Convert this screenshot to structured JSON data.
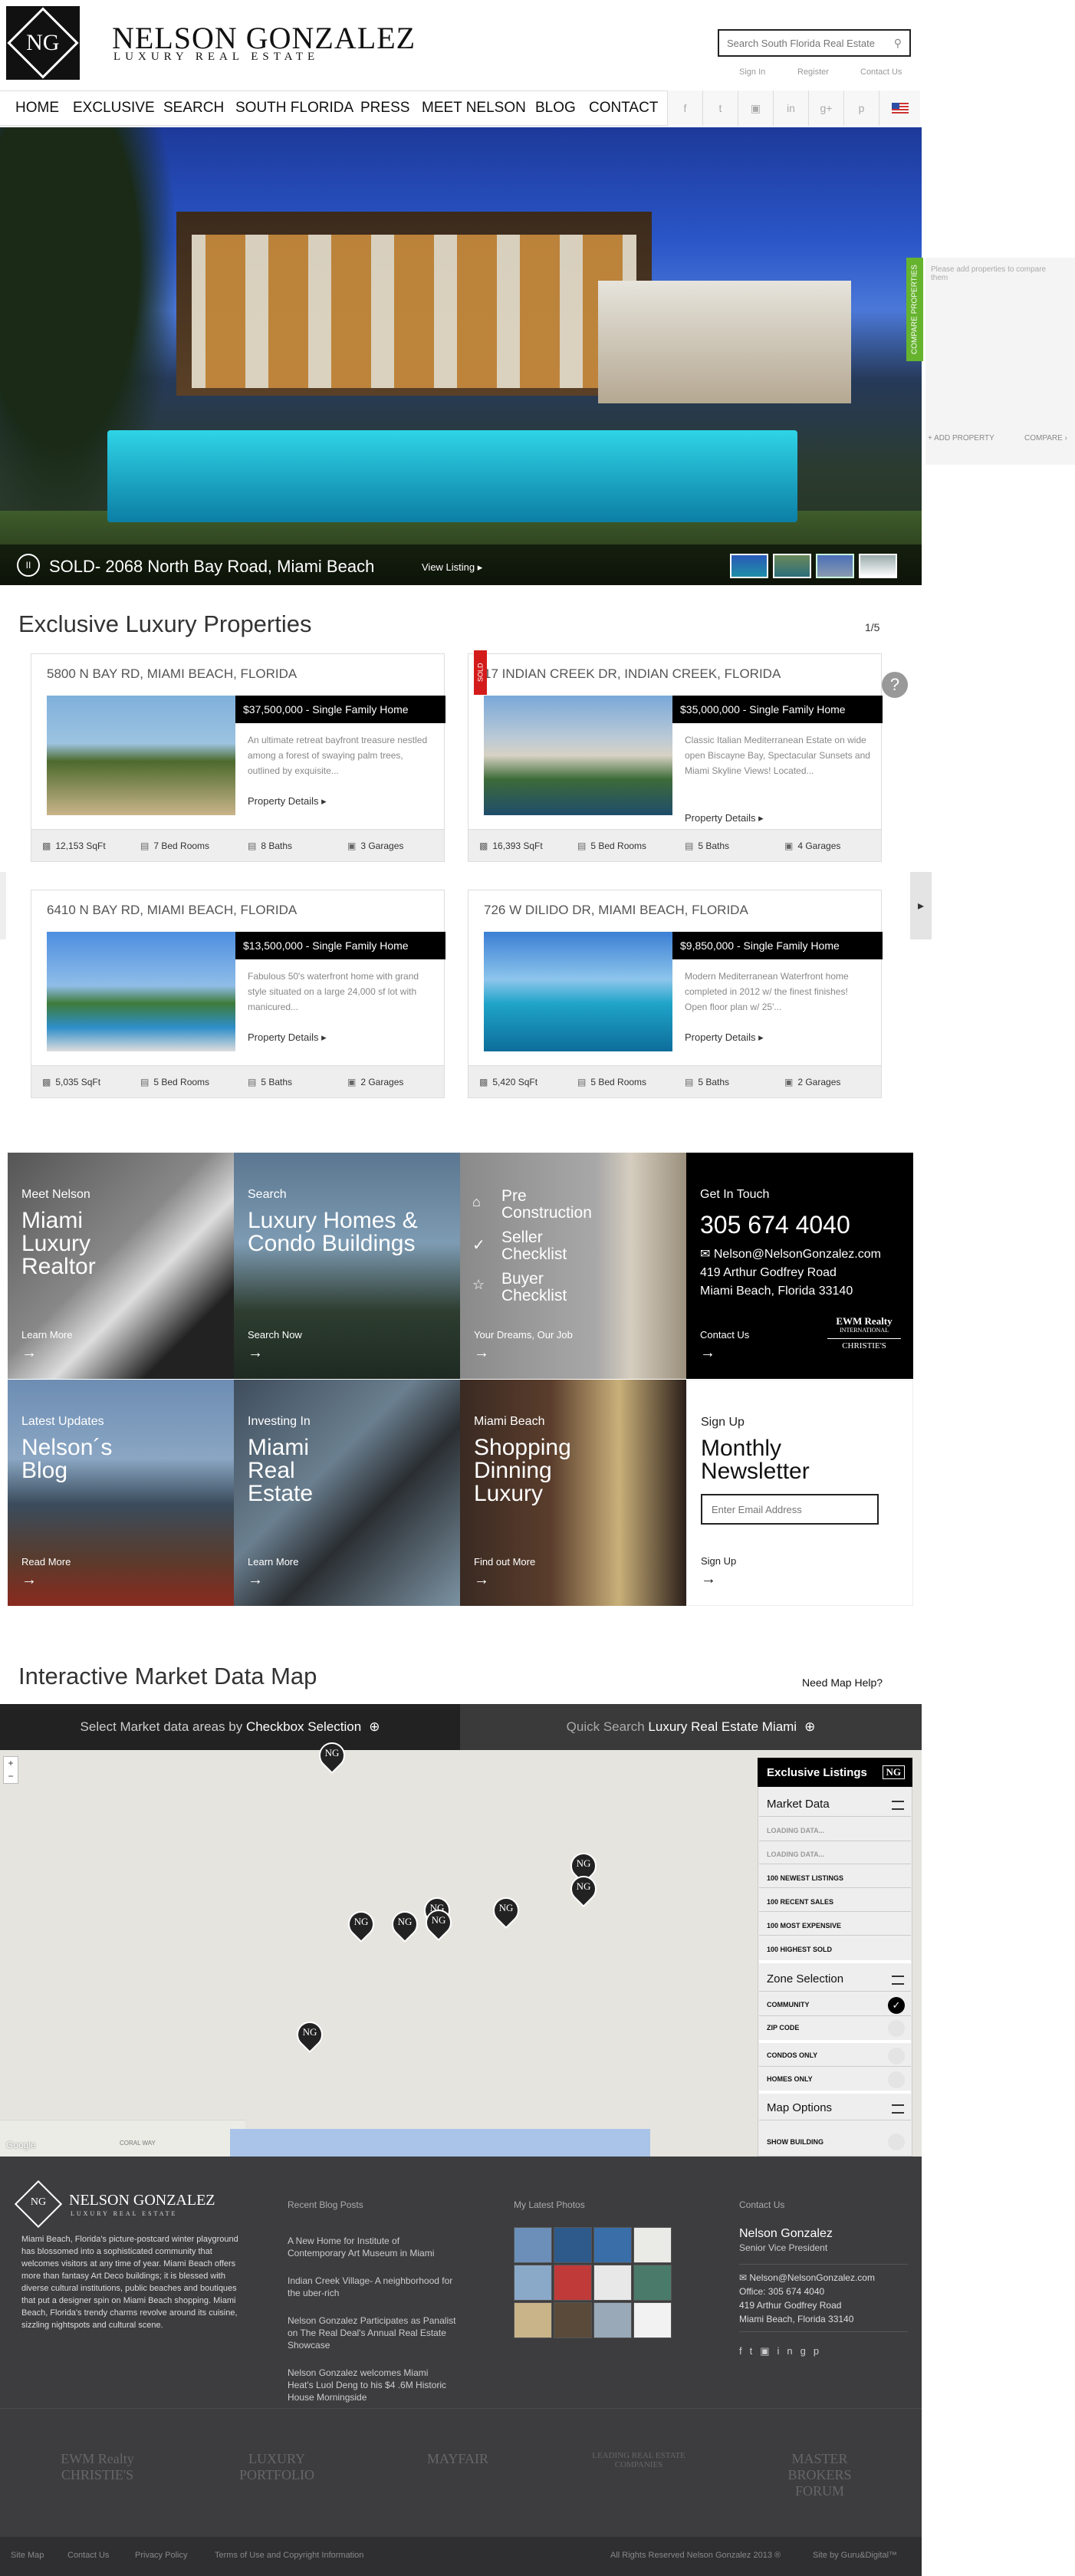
{
  "brand": {
    "mark": "NG",
    "name": "NELSON GONZALEZ",
    "tagline": "LUXURY REAL ESTATE"
  },
  "search": {
    "placeholder": "Search South Florida Real Estate"
  },
  "toplinks": [
    "Sign In",
    "Register",
    "Contact Us"
  ],
  "nav": [
    "HOME",
    "EXCLUSIVE",
    "SEARCH",
    "SOUTH FLORIDA",
    "PRESS",
    "MEET NELSON",
    "BLOG",
    "CONTACT"
  ],
  "social_icons": [
    "facebook-icon",
    "twitter-icon",
    "instagram-icon",
    "linkedin-icon",
    "google-plus-icon",
    "pinterest-icon",
    "us-flag-icon"
  ],
  "hero": {
    "caption": "SOLD- 2068 North Bay Road, Miami Beach",
    "view_listing": "View Listing ▸",
    "pause": "II"
  },
  "compare": {
    "tab": "COMPARE PROPERTIES",
    "note": "Please add properties to compare them",
    "add": "+ ADD PROPERTY",
    "compare": "COMPARE ›"
  },
  "exclusive": {
    "title": "Exclusive Luxury Properties",
    "page": "1/5",
    "sold": "SOLD",
    "details_label": "Property Details ▸",
    "properties": [
      {
        "address": "5800 N BAY RD, MIAMI BEACH, FLORIDA",
        "price": "$37,500,000 - Single Family Home",
        "desc": "An ultimate retreat bayfront treasure nestled among a forest of swaying palm trees, outlined by exquisite...",
        "sqft": "12,153 SqFt",
        "beds": "7 Bed Rooms",
        "baths": "8 Baths",
        "garages": "3 Garages"
      },
      {
        "address": "17 INDIAN CREEK DR, INDIAN CREEK, FLORIDA",
        "price": "$35,000,000 - Single Family Home",
        "desc": "Classic Italian Mediterranean Estate on wide open Biscayne Bay, Spectacular Sunsets and Miami Skyline Views! Located...",
        "sqft": "16,393 SqFt",
        "beds": "5 Bed Rooms",
        "baths": "5 Baths",
        "garages": "4 Garages"
      },
      {
        "address": "6410 N BAY RD, MIAMI BEACH, FLORIDA",
        "price": "$13,500,000 - Single Family Home",
        "desc": "Fabulous 50's waterfront home with grand style situated on a large 24,000 sf lot with manicured...",
        "sqft": "5,035 SqFt",
        "beds": "5 Bed Rooms",
        "baths": "5 Baths",
        "garages": "2 Garages"
      },
      {
        "address": "726 W DILIDO DR, MIAMI BEACH, FLORIDA",
        "price": "$9,850,000 - Single Family Home",
        "desc": "Modern Mediterranean Waterfront home completed in 2012 w/ the finest finishes! Open floor plan w/ 25'...",
        "sqft": "5,420 SqFt",
        "beds": "5 Bed Rooms",
        "baths": "5 Baths",
        "garages": "2 Garages"
      }
    ]
  },
  "tiles": {
    "meet": {
      "label": "Meet Nelson",
      "big": "Miami Luxury Realtor",
      "foot": "Learn More"
    },
    "search": {
      "label": "Search",
      "big": "Luxury Homes & Condo Buildings",
      "foot": "Search Now"
    },
    "checklist": {
      "items": [
        "Pre Construction",
        "Seller Checklist",
        "Buyer Checklist"
      ],
      "foot": "Your Dreams, Our Job"
    },
    "contact": {
      "label": "Get In Touch",
      "phone": "305 674 4040",
      "email": "Nelson@NelsonGonzalez.com",
      "addr1": "419 Arthur Godfrey Road",
      "addr2": "Miami Beach, Florida 33140",
      "foot": "Contact Us",
      "logo1": "EWM Realty",
      "logo2": "INTERNATIONAL",
      "logo3": "CHRISTIE'S"
    },
    "blog": {
      "label": "Latest Updates",
      "big": "Nelson´s Blog",
      "foot": "Read More"
    },
    "invest": {
      "label": "Investing In",
      "big": "Miami Real Estate",
      "foot": "Learn More"
    },
    "shop": {
      "label": "Miami Beach",
      "big": "Shopping Dinning Luxury",
      "foot": "Find out More"
    },
    "newsletter": {
      "label": "Sign Up",
      "big": "Monthly Newsletter",
      "placeholder": "Enter Email Address",
      "foot": "Sign Up"
    }
  },
  "map": {
    "title": "Interactive Market Data Map",
    "help": "Need Map Help?",
    "tab1_pre": "Select Market data areas by ",
    "tab1_bold": "Checkbox Selection",
    "tab2_pre": "Quick Search ",
    "tab2_bold": "Luxury Real Estate Miami",
    "google": "Google",
    "pin_label": "NG",
    "place_label": "CORAL WAY",
    "panel": {
      "title": "Exclusive Listings",
      "market": "Market Data",
      "loading": [
        "LOADING DATA...",
        "LOADING DATA..."
      ],
      "items": [
        "100 NEWEST LISTINGS",
        "100 RECENT SALES",
        "100 MOST EXPENSIVE",
        "100 HIGHEST SOLD"
      ],
      "zone": "Zone Selection",
      "zone_items": [
        "COMMUNITY",
        "ZIP CODE"
      ],
      "filters": [
        "CONDOS ONLY",
        "HOMES ONLY"
      ],
      "options": "Map Options",
      "show": "SHOW BUILDING"
    }
  },
  "footer": {
    "about": "Miami Beach, Florida's picture-postcard winter playground has blossomed into a sophisticated community that welcomes visitors at any time of year. Miami Beach offers more than fantasy Art Deco buildings; it is blessed with diverse cultural institutions, public beaches and boutiques that put a designer spin on Miami Beach shopping. Miami Beach, Florida's trendy charms revolve around its cuisine, sizzling nightspots and cultural scene.",
    "blog_title": "Recent Blog Posts",
    "posts": [
      "A New Home for Institute of Contemporary Art Museum in Miami",
      "Indian Creek Village- A neighborhood for the uber-rich",
      "Nelson Gonzalez Participates as Panalist on The Real Deal's Annual Real Estate Showcase",
      "Nelson Gonzalez welcomes Miami Heat's Luol Deng to his $4 .6M Historic House Morningside"
    ],
    "photos_title": "My Latest Photos",
    "contact_title": "Contact Us",
    "contact_name": "Nelson Gonzalez",
    "contact_role": "Senior Vice President",
    "contact_email": "Nelson@NelsonGonzalez.com",
    "contact_office": "Office: 305 674 4040",
    "contact_addr1": "419 Arthur Godfrey Road",
    "contact_addr2": "Miami Beach, Florida 33140",
    "partners": [
      "EWM Realty CHRISTIE'S",
      "LUXURY PORTFOLIO",
      "MAYFAIR",
      "LEADING REAL ESTATE COMPANIES",
      "MASTER BROKERS FORUM"
    ],
    "bottom_links": [
      "Site Map",
      "Contact Us",
      "Privacy Policy",
      "Terms of Use and Copyright Information"
    ],
    "copyright": "All Rights Reserved Nelson Gonzalez 2013 ®",
    "site_by": "Site by Guru&Digital™"
  }
}
